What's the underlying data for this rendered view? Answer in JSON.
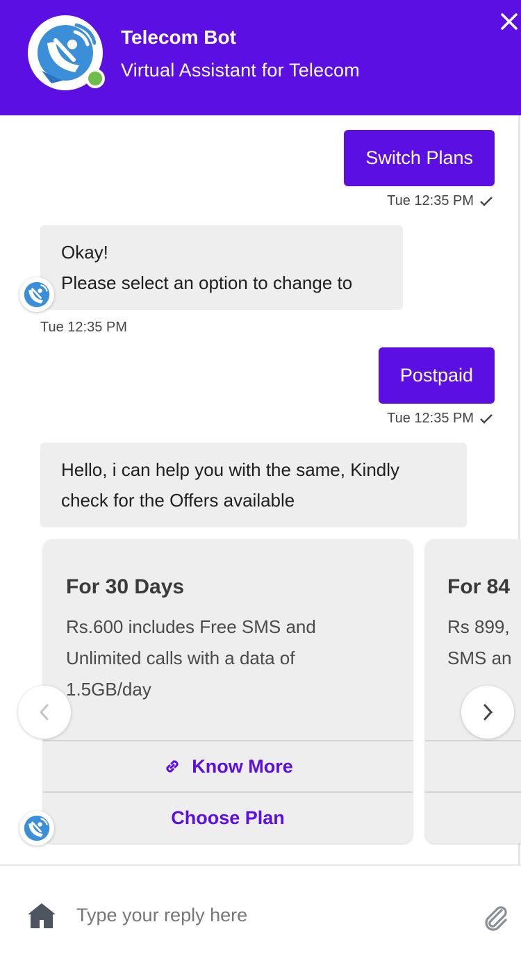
{
  "header": {
    "bot_name": "Telecom Bot",
    "bot_subtitle": "Virtual Assistant for Telecom",
    "status": "online",
    "close_icon": "close-icon",
    "colors": {
      "primary": "#5b0fe3",
      "online": "#6cbf4a",
      "bubble": "#eeeeee"
    }
  },
  "messages": [
    {
      "from": "user",
      "text": "Switch Plans",
      "time": "Tue 12:35 PM",
      "status_icon": "check-icon"
    },
    {
      "from": "bot",
      "lines": [
        "Okay!",
        "Please select an option to change to"
      ],
      "time": "Tue 12:35 PM"
    },
    {
      "from": "user",
      "text": "Postpaid",
      "time": "Tue 12:35 PM",
      "status_icon": "check-icon"
    },
    {
      "from": "bot",
      "lines": [
        "Hello, i can help you with the same, Kindly",
        "check for the Offers available"
      ]
    }
  ],
  "carousel": {
    "cards": [
      {
        "title": "For 30 Days",
        "description": "Rs.600 includes Free SMS and Unlimited calls with a data of 1.5GB/day",
        "know_more": "Know More",
        "choose": "Choose Plan"
      },
      {
        "title": "For 84",
        "description": "Rs 899, SMS an",
        "know_more": "",
        "choose": ""
      }
    ],
    "prev_icon": "chevron-left-icon",
    "next_icon": "chevron-right-icon"
  },
  "composer": {
    "placeholder": "Type your reply here",
    "home_icon": "home-icon",
    "attach_icon": "paperclip-icon"
  }
}
